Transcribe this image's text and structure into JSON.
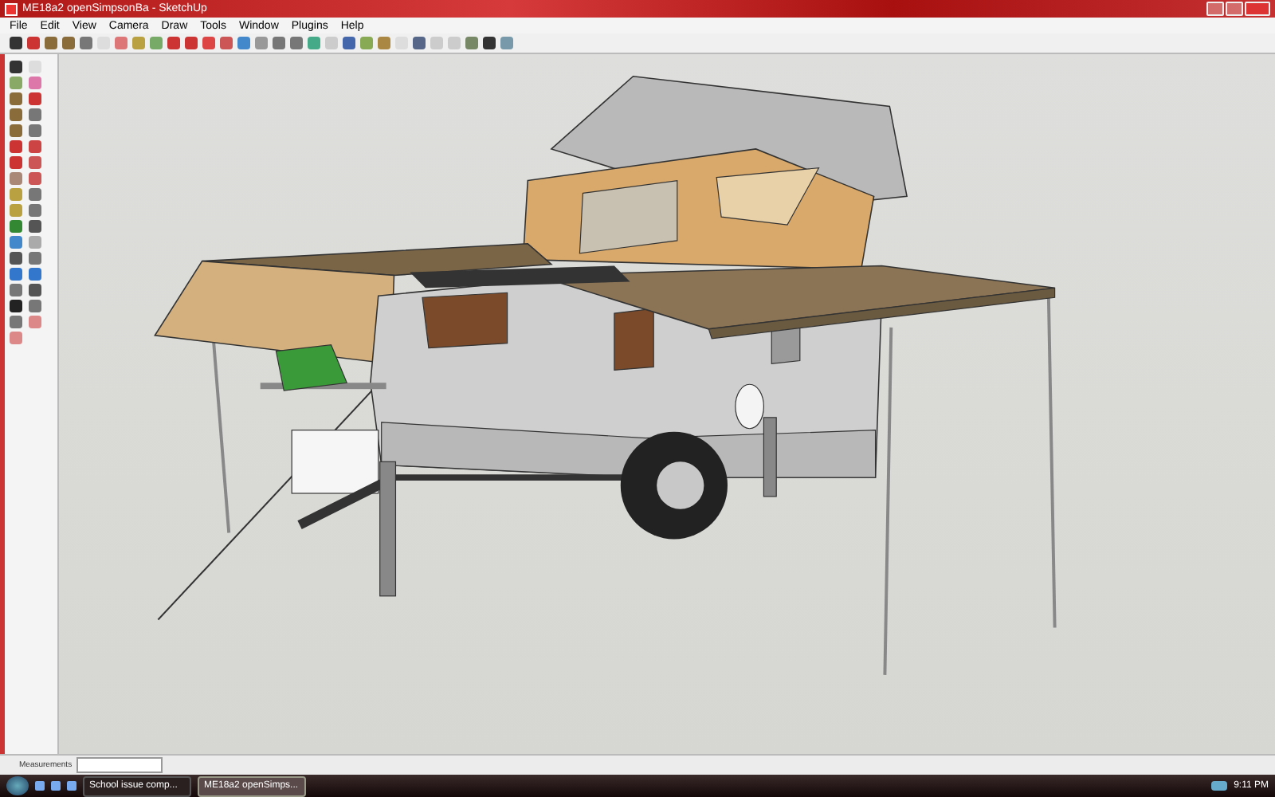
{
  "window": {
    "title": "ME18a2 openSimpsonBa - SketchUp"
  },
  "menu": [
    "File",
    "Edit",
    "View",
    "Camera",
    "Draw",
    "Tools",
    "Window",
    "Plugins",
    "Help"
  ],
  "status_bar": {
    "label": "Measurements"
  },
  "taskbar": {
    "items": [
      {
        "label": "School issue comp...",
        "selected": false
      },
      {
        "label": "ME18a2 openSimps...",
        "selected": true
      }
    ],
    "clock": "9:11 PM"
  }
}
